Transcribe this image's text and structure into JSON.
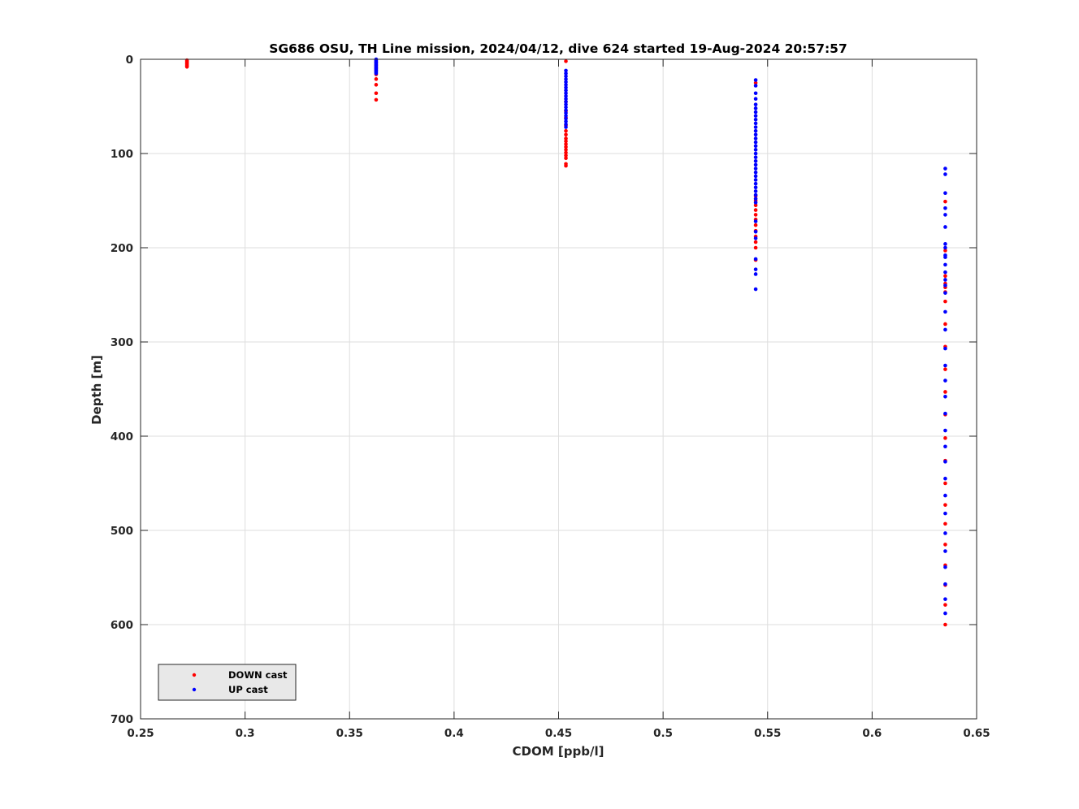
{
  "chart_data": {
    "type": "scatter",
    "title": "SG686 OSU, TH Line mission, 2024/04/12, dive 624 started 19-Aug-2024 20:57:57",
    "xlabel": "CDOM [ppb/l]",
    "ylabel": "Depth [m]",
    "xlim": [
      0.25,
      0.65
    ],
    "ylim": [
      0,
      700
    ],
    "y_reversed": true,
    "grid": true,
    "x_ticks": [
      "0.25",
      "0.3",
      "0.35",
      "0.4",
      "0.45",
      "0.5",
      "0.55",
      "0.6",
      "0.65"
    ],
    "y_ticks": [
      "0",
      "100",
      "200",
      "300",
      "400",
      "500",
      "600",
      "700"
    ],
    "legend_position": "bottom-left",
    "series": [
      {
        "name": "DOWN cast",
        "color": "#ff0000",
        "points": [
          [
            0.2722,
            1
          ],
          [
            0.2722,
            2
          ],
          [
            0.2722,
            3
          ],
          [
            0.2722,
            4
          ],
          [
            0.2722,
            5
          ],
          [
            0.2722,
            6
          ],
          [
            0.2722,
            7
          ],
          [
            0.2722,
            8
          ],
          [
            0.3627,
            3
          ],
          [
            0.3627,
            6
          ],
          [
            0.3627,
            9
          ],
          [
            0.3627,
            12
          ],
          [
            0.3627,
            16
          ],
          [
            0.3627,
            21
          ],
          [
            0.3627,
            27
          ],
          [
            0.3627,
            36
          ],
          [
            0.3627,
            43
          ],
          [
            0.4535,
            2
          ],
          [
            0.4535,
            45
          ],
          [
            0.4535,
            55
          ],
          [
            0.4535,
            62
          ],
          [
            0.4535,
            70
          ],
          [
            0.4535,
            76
          ],
          [
            0.4535,
            80
          ],
          [
            0.4535,
            84
          ],
          [
            0.4535,
            87
          ],
          [
            0.4535,
            90
          ],
          [
            0.4535,
            93
          ],
          [
            0.4535,
            96
          ],
          [
            0.4535,
            99
          ],
          [
            0.4535,
            102
          ],
          [
            0.4535,
            105
          ],
          [
            0.4535,
            111
          ],
          [
            0.4535,
            113
          ],
          [
            0.5443,
            25
          ],
          [
            0.5443,
            145
          ],
          [
            0.5443,
            150
          ],
          [
            0.5443,
            155
          ],
          [
            0.5443,
            160
          ],
          [
            0.5443,
            165
          ],
          [
            0.5443,
            170
          ],
          [
            0.5443,
            176
          ],
          [
            0.5443,
            182
          ],
          [
            0.5443,
            188
          ],
          [
            0.5443,
            194
          ],
          [
            0.5443,
            200
          ],
          [
            0.5443,
            213
          ],
          [
            0.635,
            151
          ],
          [
            0.635,
            203
          ],
          [
            0.635,
            230
          ],
          [
            0.635,
            238
          ],
          [
            0.635,
            242
          ],
          [
            0.635,
            247
          ],
          [
            0.635,
            257
          ],
          [
            0.635,
            281
          ],
          [
            0.635,
            305
          ],
          [
            0.635,
            329
          ],
          [
            0.635,
            353
          ],
          [
            0.635,
            377
          ],
          [
            0.635,
            402
          ],
          [
            0.635,
            426
          ],
          [
            0.635,
            450
          ],
          [
            0.635,
            473
          ],
          [
            0.635,
            493
          ],
          [
            0.635,
            515
          ],
          [
            0.635,
            537
          ],
          [
            0.635,
            558
          ],
          [
            0.635,
            579
          ],
          [
            0.635,
            600
          ]
        ]
      },
      {
        "name": "UP cast",
        "color": "#0000ff",
        "points": [
          [
            0.3627,
            0
          ],
          [
            0.3627,
            1
          ],
          [
            0.3627,
            2
          ],
          [
            0.3627,
            3
          ],
          [
            0.3627,
            4
          ],
          [
            0.3627,
            5
          ],
          [
            0.3627,
            6
          ],
          [
            0.3627,
            7
          ],
          [
            0.3627,
            8
          ],
          [
            0.3627,
            9
          ],
          [
            0.3627,
            10
          ],
          [
            0.3627,
            11
          ],
          [
            0.3627,
            12
          ],
          [
            0.3627,
            13
          ],
          [
            0.3627,
            14
          ],
          [
            0.3627,
            15
          ],
          [
            0.4535,
            12
          ],
          [
            0.4535,
            15
          ],
          [
            0.4535,
            18
          ],
          [
            0.4535,
            21
          ],
          [
            0.4535,
            24
          ],
          [
            0.4535,
            27
          ],
          [
            0.4535,
            30
          ],
          [
            0.4535,
            33
          ],
          [
            0.4535,
            36
          ],
          [
            0.4535,
            39
          ],
          [
            0.4535,
            42
          ],
          [
            0.4535,
            45
          ],
          [
            0.4535,
            48
          ],
          [
            0.4535,
            51
          ],
          [
            0.4535,
            54
          ],
          [
            0.4535,
            57
          ],
          [
            0.4535,
            60
          ],
          [
            0.4535,
            63
          ],
          [
            0.4535,
            66
          ],
          [
            0.4535,
            69
          ],
          [
            0.4535,
            72
          ],
          [
            0.5443,
            22
          ],
          [
            0.5443,
            28
          ],
          [
            0.5443,
            36
          ],
          [
            0.5443,
            42
          ],
          [
            0.5443,
            48
          ],
          [
            0.5443,
            52
          ],
          [
            0.5443,
            56
          ],
          [
            0.5443,
            60
          ],
          [
            0.5443,
            64
          ],
          [
            0.5443,
            68
          ],
          [
            0.5443,
            72
          ],
          [
            0.5443,
            76
          ],
          [
            0.5443,
            80
          ],
          [
            0.5443,
            84
          ],
          [
            0.5443,
            88
          ],
          [
            0.5443,
            92
          ],
          [
            0.5443,
            96
          ],
          [
            0.5443,
            100
          ],
          [
            0.5443,
            104
          ],
          [
            0.5443,
            108
          ],
          [
            0.5443,
            112
          ],
          [
            0.5443,
            116
          ],
          [
            0.5443,
            120
          ],
          [
            0.5443,
            124
          ],
          [
            0.5443,
            128
          ],
          [
            0.5443,
            132
          ],
          [
            0.5443,
            136
          ],
          [
            0.5443,
            140
          ],
          [
            0.5443,
            144
          ],
          [
            0.5443,
            148
          ],
          [
            0.5443,
            152
          ],
          [
            0.5443,
            172
          ],
          [
            0.5443,
            183
          ],
          [
            0.5443,
            190
          ],
          [
            0.5443,
            212
          ],
          [
            0.5443,
            223
          ],
          [
            0.5443,
            228
          ],
          [
            0.5443,
            244
          ],
          [
            0.635,
            116
          ],
          [
            0.635,
            122
          ],
          [
            0.635,
            142
          ],
          [
            0.635,
            158
          ],
          [
            0.635,
            165
          ],
          [
            0.635,
            178
          ],
          [
            0.635,
            196
          ],
          [
            0.635,
            200
          ],
          [
            0.635,
            208
          ],
          [
            0.635,
            210
          ],
          [
            0.635,
            218
          ],
          [
            0.635,
            226
          ],
          [
            0.635,
            234
          ],
          [
            0.635,
            240
          ],
          [
            0.635,
            248
          ],
          [
            0.635,
            268
          ],
          [
            0.635,
            287
          ],
          [
            0.635,
            307
          ],
          [
            0.635,
            325
          ],
          [
            0.635,
            341
          ],
          [
            0.635,
            358
          ],
          [
            0.635,
            376
          ],
          [
            0.635,
            394
          ],
          [
            0.635,
            411
          ],
          [
            0.635,
            427
          ],
          [
            0.635,
            445
          ],
          [
            0.635,
            463
          ],
          [
            0.635,
            482
          ],
          [
            0.635,
            503
          ],
          [
            0.635,
            522
          ],
          [
            0.635,
            539
          ],
          [
            0.635,
            557
          ],
          [
            0.635,
            573
          ],
          [
            0.635,
            588
          ]
        ]
      }
    ]
  }
}
